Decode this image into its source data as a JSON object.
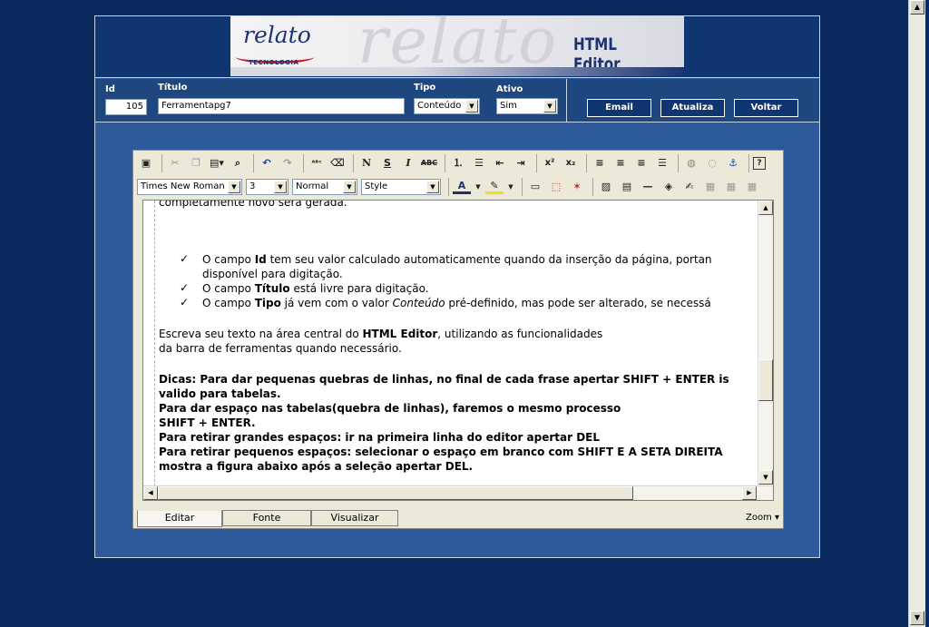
{
  "header": {
    "brand": "relato",
    "brand_sub": "TECNOLOGIA",
    "app_title": "HTML Editor",
    "watermark": "relato"
  },
  "form": {
    "id_label": "Id",
    "id_value": "105",
    "titulo_label": "Título",
    "titulo_value": "Ferramentapg7",
    "tipo_label": "Tipo",
    "tipo_value": "Conteúdo",
    "ativo_label": "Ativo",
    "ativo_value": "Sim"
  },
  "buttons": {
    "email": "Email",
    "atualiza": "Atualiza",
    "voltar": "Voltar"
  },
  "toolbar": {
    "font": "Times New Roman",
    "size": "3",
    "format": "Normal",
    "style": "Style"
  },
  "content": {
    "line0": "completamente novo será gerada.",
    "b1_pre": "O campo ",
    "b1_bold": "Id",
    "b1_post": " tem seu valor calculado automaticamente quando da inserção da página, portan",
    "b1_cont": "disponível para digitação.",
    "b2_pre": "O campo ",
    "b2_bold": "Título",
    "b2_post": " está livre para digitação.",
    "b3_pre": "O campo ",
    "b3_bold": "Tipo",
    "b3_mid": " já vem com o valor ",
    "b3_ital": "Conteúdo",
    "b3_post": " pré-definido, mas pode ser alterado, se necessá",
    "p1_pre": "Escreva seu texto na área central do ",
    "p1_bold": "HTML Editor",
    "p1_post": ", utilizando as funcionalidades",
    "p1_cont": "da barra de ferramentas quando necessário.",
    "d1": "Dicas: Para dar pequenas quebras de linhas, no final de cada frase apertar SHIFT + ENTER is",
    "d2": "valido para tabelas.",
    "d3": "Para dar espaço nas tabelas(quebra de linhas), faremos o mesmo processo",
    "d4": "SHIFT + ENTER.",
    "d5": "Para retirar grandes espaços: ir na primeira linha do editor apertar DEL",
    "d6": "Para retirar pequenos espaços: selecionar o espaço em branco com SHIFT E A SETA DIREITA",
    "d7": "mostra a figura abaixo após a seleção apertar DEL."
  },
  "tabs": [
    "Editar",
    "Fonte",
    "Visualizar"
  ],
  "zoom": "Zoom ▾",
  "icons": {
    "check": "✓"
  }
}
